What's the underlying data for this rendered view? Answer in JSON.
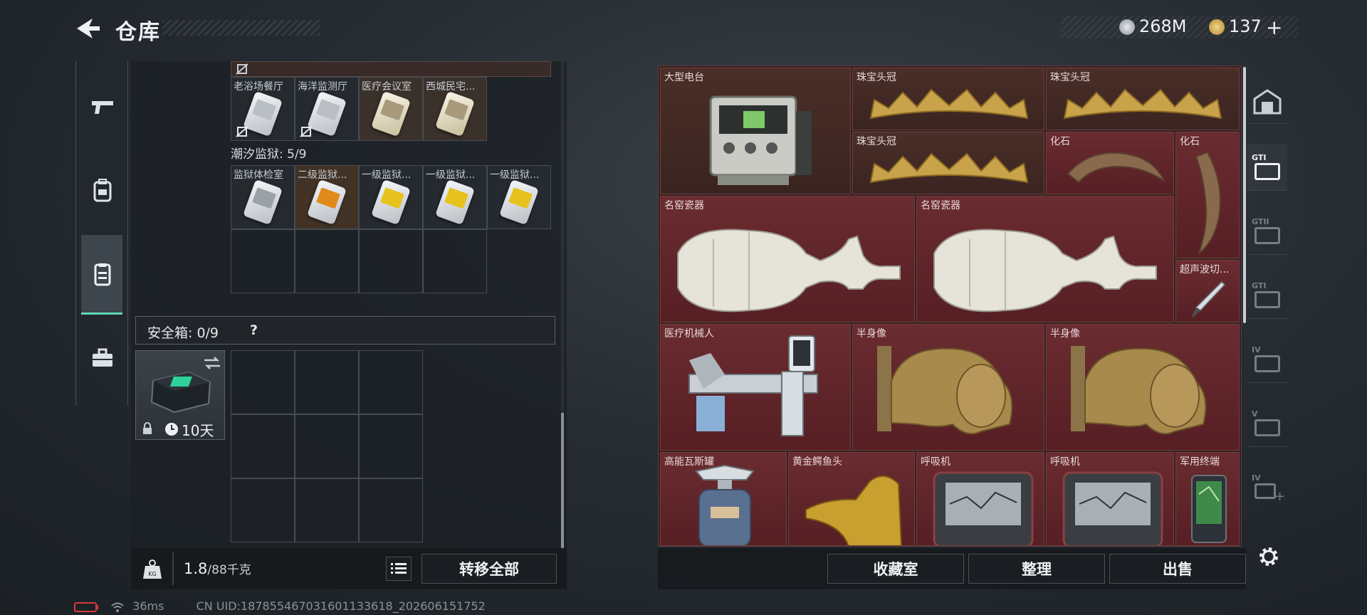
{
  "header": {
    "title": "仓库",
    "currency_silver": "268M",
    "currency_gold": "137",
    "add_symbol": "+"
  },
  "left_nav": {
    "items": [
      "weapon-icon",
      "backpack-icon",
      "vest-icon",
      "toolbox-icon"
    ],
    "active_index": 2
  },
  "keycards": {
    "top_row": [
      {
        "label": "老浴场餐厅",
        "tone": "white",
        "no_drop": true
      },
      {
        "label": "海洋监测厅",
        "tone": "white",
        "no_drop": true
      },
      {
        "label": "医疗会议室",
        "tone": "warm",
        "no_drop": false
      },
      {
        "label": "西城民宅...",
        "tone": "warm",
        "no_drop": false
      }
    ],
    "prison_section": "潮汐监狱: 5/9",
    "prison_row": [
      {
        "label": "监狱体检室",
        "tone": "gray"
      },
      {
        "label": "二级监狱...",
        "tone": "orange"
      },
      {
        "label": "一级监狱...",
        "tone": "yellow"
      },
      {
        "label": "一级监狱...",
        "tone": "yellow"
      },
      {
        "label": "一级监狱...",
        "tone": "yellow"
      }
    ]
  },
  "safebox": {
    "label": "安全箱: 0/9",
    "help": "?",
    "duration": "10天"
  },
  "weight": {
    "current": "1.8",
    "capacity": "/88千克"
  },
  "transfer_all": "转移全部",
  "warehouse_items": [
    {
      "name": "大型电台",
      "kind": "radio"
    },
    {
      "name": "珠宝头冠",
      "kind": "crown"
    },
    {
      "name": "珠宝头冠",
      "kind": "crown"
    },
    {
      "name": "珠宝头冠",
      "kind": "crown"
    },
    {
      "name": "化石",
      "kind": "claw"
    },
    {
      "name": "化石",
      "kind": "claw-v"
    },
    {
      "name": "名窑瓷器",
      "kind": "vase"
    },
    {
      "name": "名窑瓷器",
      "kind": "vase"
    },
    {
      "name": "超声波切...",
      "kind": "knife"
    },
    {
      "name": "医疗机械人",
      "kind": "robot"
    },
    {
      "name": "半身像",
      "kind": "bust"
    },
    {
      "name": "半身像",
      "kind": "bust"
    },
    {
      "name": "高能瓦斯罐",
      "kind": "gas"
    },
    {
      "name": "黄金鳄鱼头",
      "kind": "croc"
    },
    {
      "name": "呼吸机",
      "kind": "ventilator"
    },
    {
      "name": "呼吸机",
      "kind": "ventilator"
    },
    {
      "name": "军用终端",
      "kind": "terminal"
    }
  ],
  "right_nav": {
    "labels": [
      "",
      "GTI",
      "GTII",
      "GTI",
      "IV",
      "V",
      "IV"
    ]
  },
  "bottom_buttons": {
    "collection": "收藏室",
    "sort": "整理",
    "sell": "出售"
  },
  "status": {
    "ping": "36ms",
    "uid": "CN UID:187855467031601133618_202606151752"
  },
  "colors": {
    "accent": "#5ed6b6",
    "rare_red": "#6a2c30",
    "rare_brown": "#4a2e28"
  }
}
